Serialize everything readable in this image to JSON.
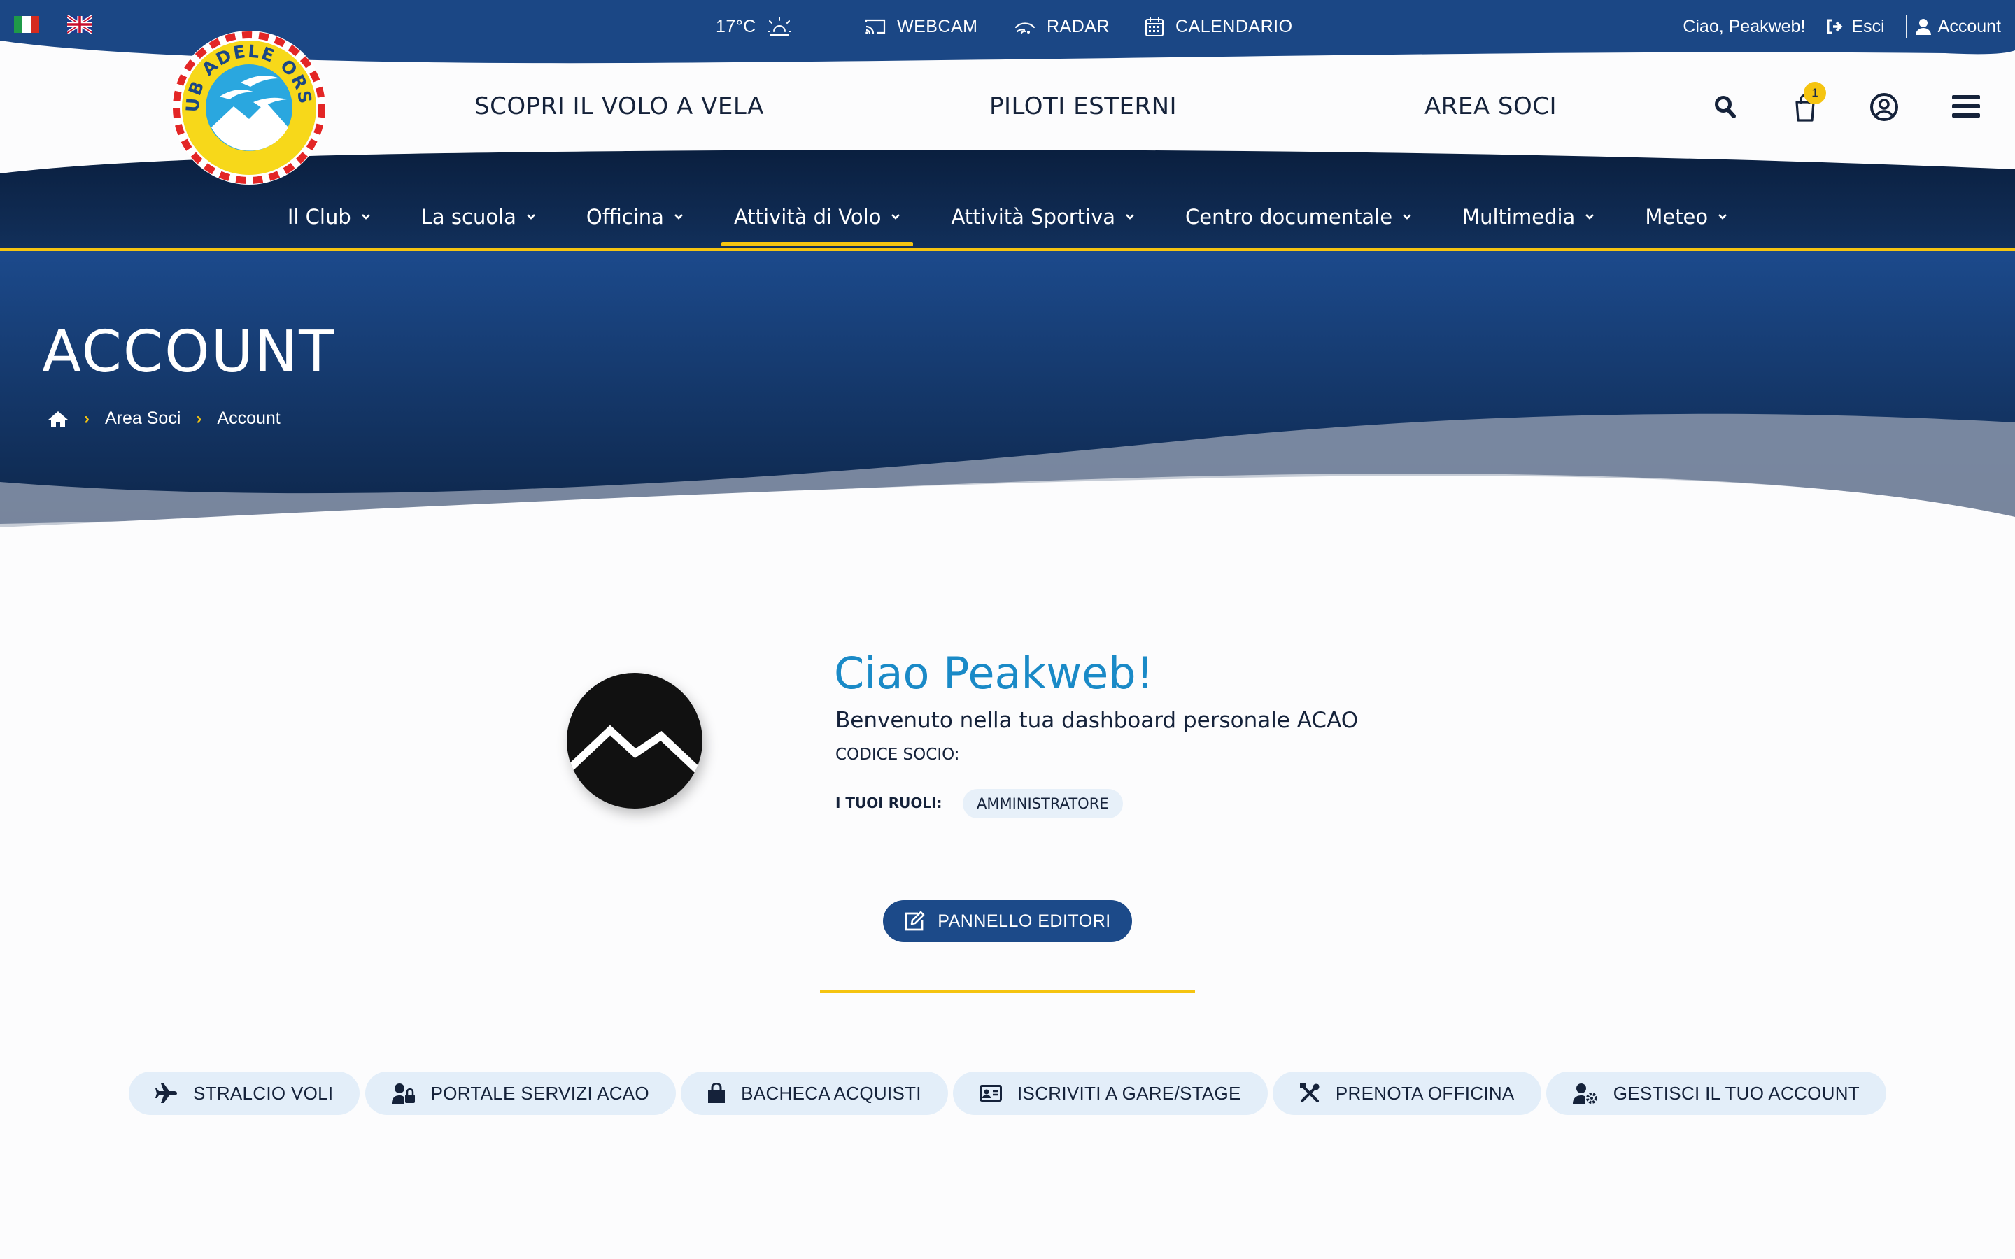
{
  "topbar": {
    "lang_it": "Italiano",
    "lang_en": "English",
    "temperature": "17°C",
    "weather_icon": "partly-sunny-icon",
    "webcam": "WEBCAM",
    "radar": "RADAR",
    "calendario": "CALENDARIO",
    "greeting": "Ciao, Peakweb!",
    "logout": "Esci",
    "account": "Account"
  },
  "logo": {
    "text": "AERO CLUB ADELE ORSI VARESE"
  },
  "header": {
    "links": [
      "SCOPRI IL VOLO A VELA",
      "PILOTI ESTERNI",
      "AREA SOCI"
    ],
    "cart_count": "1"
  },
  "nav": {
    "items": [
      "Il Club",
      "La scuola",
      "Officina",
      "Attività di Volo",
      "Attività Sportiva",
      "Centro documentale",
      "Multimedia",
      "Meteo"
    ],
    "active": "Attività di Volo"
  },
  "hero": {
    "title": "ACCOUNT",
    "breadcrumb": [
      "Area Soci",
      "Account"
    ]
  },
  "profile": {
    "greeting": "Ciao Peakweb!",
    "welcome": "Benvenuto nella tua dashboard personale ACAO",
    "member_code_label": "CODICE SOCIO:",
    "roles_label": "I TUOI RUOLI:",
    "role": "AMMINISTRATORE",
    "editor_button": "PANNELLO EDITORI"
  },
  "quick_actions": [
    {
      "label": "STRALCIO VOLI",
      "icon": "plane-icon"
    },
    {
      "label": "PORTALE SERVIZI ACAO",
      "icon": "user-lock-icon"
    },
    {
      "label": "BACHECA ACQUISTI",
      "icon": "shopping-bag-icon"
    },
    {
      "label": "ISCRIVITI A GARE/STAGE",
      "icon": "id-card-icon"
    },
    {
      "label": "PRENOTA OFFICINA",
      "icon": "tools-icon"
    },
    {
      "label": "GESTISCI IL TUO ACCOUNT",
      "icon": "user-gear-icon"
    }
  ],
  "colors": {
    "brand_blue": "#1c4a89",
    "navy": "#0d2548",
    "accent_yellow": "#f5c411",
    "link_blue": "#1a8ac7",
    "pill_bg": "#e3eef9"
  }
}
